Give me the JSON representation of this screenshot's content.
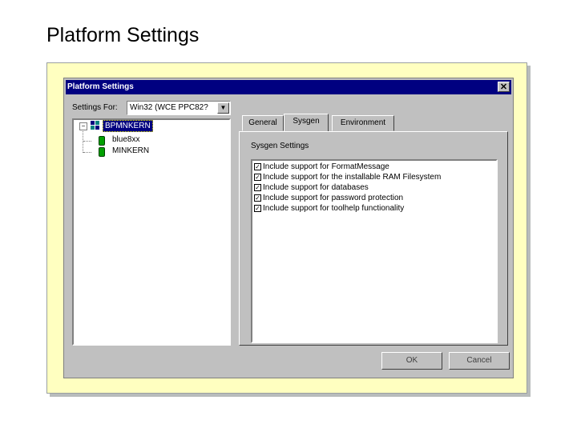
{
  "slide": {
    "title": "Platform Settings"
  },
  "dialog": {
    "title": "Platform Settings",
    "close_glyph": "✕",
    "settings_for_label": "Settings For:",
    "settings_for_value": "Win32 (WCE PPC82?",
    "combo_arrow": "▼",
    "tree": {
      "expander": "−",
      "root": "BPMNKERN",
      "children": [
        "blue8xx",
        "MINKERN"
      ]
    },
    "tabs": [
      "General",
      "Sysgen",
      "Environment"
    ],
    "active_tab": "Sysgen",
    "group_label": "Sysgen Settings",
    "check_glyph": "✓",
    "options": [
      "Include support for FormatMessage",
      "Include support for the installable RAM Filesystem",
      "Include support for databases",
      "Include support for password protection",
      "Include support for toolhelp functionality"
    ],
    "ok_label": "OK",
    "cancel_label": "Cancel"
  }
}
